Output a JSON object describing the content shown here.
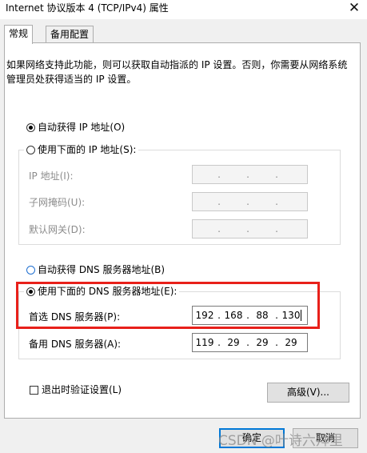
{
  "window": {
    "title": "Internet 协议版本 4 (TCP/IPv4) 属性",
    "close_glyph": "✕"
  },
  "tabs": [
    {
      "label": "常规",
      "active": true
    },
    {
      "label": "备用配置",
      "active": false
    }
  ],
  "description": "如果网络支持此功能，则可以获取自动指派的 IP 设置。否则，你需要从网络系统管理员处获得适当的 IP 设置。",
  "ip_section": {
    "auto_label": "自动获得 IP 地址(O)",
    "manual_label": "使用下面的 IP 地址(S):",
    "selected": "auto",
    "fields": [
      {
        "label": "IP 地址(I):",
        "octets": [
          "",
          "",
          "",
          ""
        ]
      },
      {
        "label": "子网掩码(U):",
        "octets": [
          "",
          "",
          "",
          ""
        ]
      },
      {
        "label": "默认网关(D):",
        "octets": [
          "",
          "",
          "",
          ""
        ]
      }
    ]
  },
  "dns_section": {
    "auto_label": "自动获得 DNS 服务器地址(B)",
    "manual_label": "使用下面的 DNS 服务器地址(E):",
    "selected": "manual",
    "preferred": {
      "label": "首选 DNS 服务器(P):",
      "octets": [
        "192",
        "168",
        "88",
        "130"
      ]
    },
    "alternate": {
      "label": "备用 DNS 服务器(A):",
      "octets": [
        "119",
        "29",
        "29",
        "29"
      ]
    }
  },
  "validate_label": "退出时验证设置(L)",
  "advanced_label": "高级(V)...",
  "ok_label": "确定",
  "cancel_label": "取消",
  "watermark": "CSDN @叶诗六拜里",
  "colors": {
    "highlight": "#e8201a",
    "radio_blue": "#1f6fd0",
    "default_button": "#0078d7"
  }
}
